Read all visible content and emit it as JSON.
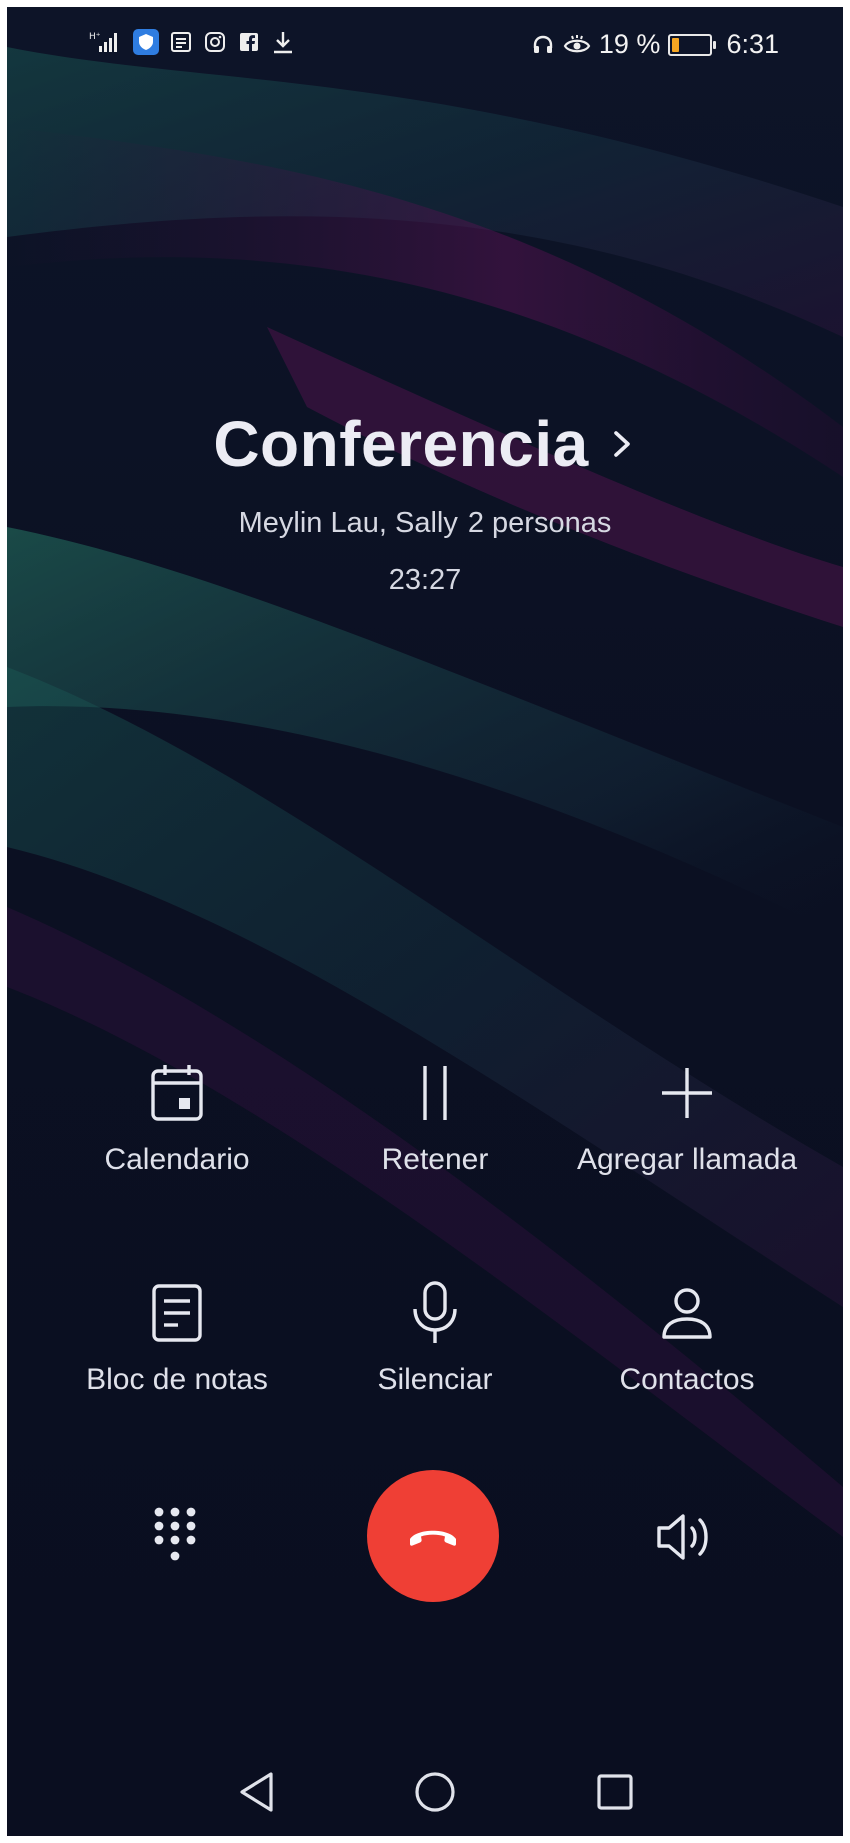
{
  "status_bar": {
    "left_icons": [
      "signal-icon",
      "vpn-shield-icon",
      "news-icon",
      "instagram-icon",
      "facebook-icon",
      "download-icon"
    ],
    "right_icons": [
      "headphones-icon",
      "eye-comfort-icon"
    ],
    "battery_percent_text": "19 %",
    "battery_level": 0.19,
    "battery_color": "#f5a623",
    "time": "6:31"
  },
  "call": {
    "title": "Conferencia",
    "participants": "Meylin Lau, Sally",
    "participant_count": "2 personas",
    "duration": "23:27"
  },
  "actions": [
    {
      "label": "Calendario",
      "icon": "calendar-icon"
    },
    {
      "label": "Retener",
      "icon": "pause-icon"
    },
    {
      "label": "Agregar llamada",
      "icon": "plus-icon"
    },
    {
      "label": "Bloc de notas",
      "icon": "notepad-icon"
    },
    {
      "label": "Silenciar",
      "icon": "microphone-icon"
    },
    {
      "label": "Contactos",
      "icon": "contact-icon"
    }
  ],
  "bottom_controls": {
    "keypad_icon": "dialpad-icon",
    "end_call_icon": "end-call-icon",
    "end_call_color": "#ef3f35",
    "speaker_icon": "speaker-icon"
  },
  "nav_bar": {
    "back_icon": "back-triangle-icon",
    "home_icon": "home-circle-icon",
    "recents_icon": "recents-square-icon"
  }
}
